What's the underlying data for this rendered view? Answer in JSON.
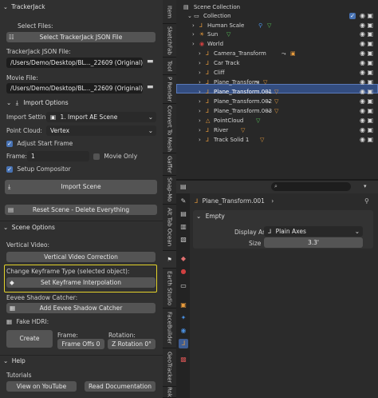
{
  "left_panel": {
    "title": "TrackerJack",
    "select_files_label": "Select Files:",
    "select_json_button": "Select TrackerJack JSON File",
    "json_file_label": "TrackerJack JSON File:",
    "json_file_value": "/Users/Demo/Desktop/BL..._22609 (Original).mp4",
    "movie_file_label": "Movie File:",
    "movie_file_value": "/Users/Demo/Desktop/BL..._22609 (Original).mp4",
    "import_options_label": "Import Options",
    "import_settings_label": "Import Settin...",
    "import_settings_value": "1. Import AE Scene",
    "point_cloud_label": "Point Cloud:",
    "point_cloud_value": "Vertex",
    "adjust_start_frame_label": "Adjust Start Frame",
    "frame_label": "Frame:",
    "frame_value": "1",
    "movie_only_label": "Movie Only",
    "setup_compositor_label": "Setup Compositor",
    "import_scene_button": "Import Scene",
    "reset_scene_button": "Reset Scene - Delete Everything",
    "scene_options_label": "Scene Options",
    "vertical_video_label": "Vertical Video:",
    "vertical_video_button": "Vertical Video Correction",
    "change_keyframe_label": "Change Keyframe Type (selected object):",
    "set_keyframe_button": "Set Keyframe Interpolation",
    "eevee_label": "Eevee Shadow Catcher:",
    "eevee_button": "Add Eevee Shadow Catcher",
    "fake_hdri_label": "Fake HDRI:",
    "create_button": "Create",
    "frame_col_label": "Frame:",
    "rotation_col_label": "Rotation:",
    "frame_offs_value": "Frame Offs  0",
    "z_rotation_value": "Z Rotation  0°",
    "help_label": "Help",
    "tutorials_label": "Tutorials",
    "youtube_button": "View on YouTube",
    "docs_button": "Read Documentation"
  },
  "vertical_tabs": [
    "Item",
    "SketchFab",
    "Tool",
    "P Render",
    "Convert To Mesh",
    "Gaffer",
    "Snap-Mo",
    "Alt Tab Ocean",
    "Earth Studio",
    "FaceBuilder",
    "GeoTracker",
    "Rok"
  ],
  "outliner": {
    "scene_collection": "Scene Collection",
    "collection": "Collection",
    "items": [
      {
        "name": "Human Scale",
        "icon": "empty-icon"
      },
      {
        "name": "Sun",
        "icon": "light-icon"
      },
      {
        "name": "World",
        "icon": "world-icon"
      },
      {
        "name": "Camera_Transform",
        "icon": "empty-icon"
      },
      {
        "name": "Car Track",
        "icon": "empty-icon"
      },
      {
        "name": "Cliff",
        "icon": "empty-icon"
      },
      {
        "name": "Plane_Transform",
        "icon": "empty-icon"
      },
      {
        "name": "Plane_Transform.001",
        "icon": "empty-icon"
      },
      {
        "name": "Plane_Transform.002",
        "icon": "empty-icon"
      },
      {
        "name": "Plane_Transform.003",
        "icon": "empty-icon"
      },
      {
        "name": "PointCloud",
        "icon": "mesh-icon"
      },
      {
        "name": "River",
        "icon": "empty-icon"
      },
      {
        "name": "Track Solid 1",
        "icon": "empty-icon"
      }
    ]
  },
  "properties": {
    "object_name": "Plane_Transform.001",
    "section": "Empty",
    "display_as_label": "Display As",
    "display_as_value": "Plain Axes",
    "size_label": "Size",
    "size_value": "3.3'"
  },
  "colors": {
    "highlight_box": "#e3d22a",
    "selected_row": "#334d80",
    "accent_blue": "#4772b3"
  }
}
